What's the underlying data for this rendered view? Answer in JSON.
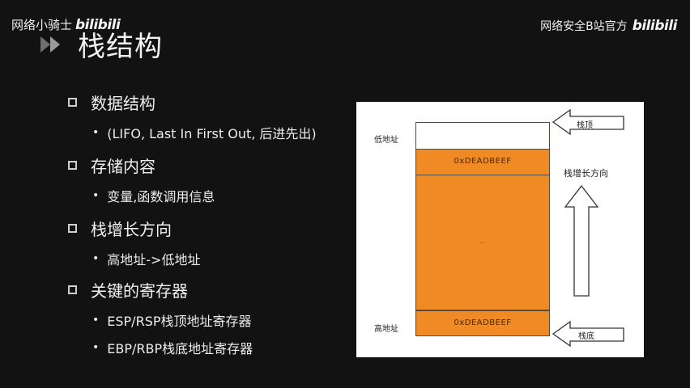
{
  "watermark": {
    "left_text": "网络小骑士",
    "left_logo": "bilibili",
    "right_text": "网络安全B站官方",
    "right_logo": "bilibili"
  },
  "slide": {
    "icon": "double-arrow-icon",
    "title": "栈结构"
  },
  "outline": [
    {
      "heading": "数据结构",
      "items": [
        "(LIFO, Last In First Out, 后进先出)"
      ]
    },
    {
      "heading": "存储内容",
      "items": [
        "变量,函数调用信息"
      ]
    },
    {
      "heading": "栈增长方向",
      "items": [
        "高地址->低地址"
      ]
    },
    {
      "heading": "关键的寄存器",
      "items": [
        "ESP/RSP栈顶地址寄存器",
        "EBP/RBP栈底地址寄存器"
      ]
    }
  ],
  "diagram": {
    "low_addr": "低地址",
    "high_addr": "高地址",
    "top_cell": "0xDEADBEEF",
    "bottom_cell": "0xDEADBEEF",
    "middle_mark": "..",
    "stack_top": "栈顶",
    "stack_bottom": "栈底",
    "growth": "栈增长方向",
    "colors": {
      "orange": "#f08a24",
      "white": "#ffffff"
    }
  }
}
